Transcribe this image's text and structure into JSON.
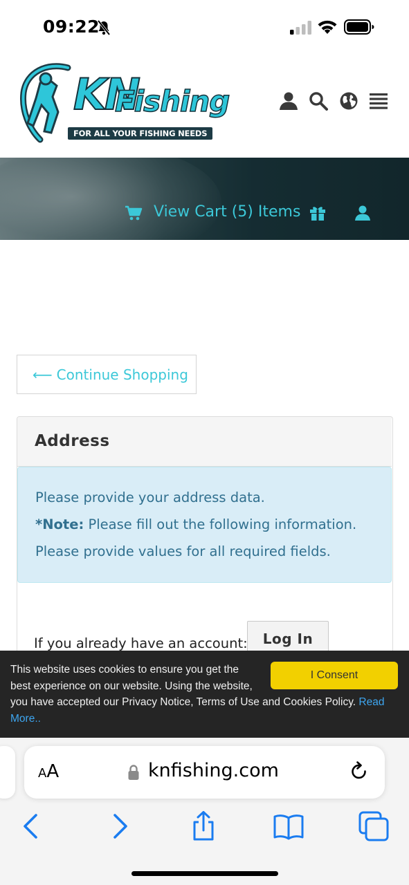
{
  "status_bar": {
    "time": "09:22"
  },
  "header": {
    "logo_kn": "KN",
    "logo_fishing": "Fishing",
    "logo_tagline": "FOR ALL YOUR FISHING NEEDS"
  },
  "banner": {
    "view_cart": "View Cart (5) Items"
  },
  "continue_shopping": {
    "arrow": "⟵",
    "label": "Continue Shopping"
  },
  "address": {
    "title": "Address",
    "info_line_1": "Please provide your address data.",
    "note_label": "*Note:",
    "note_text": " Please fill out the following information.",
    "info_line_3": "Please provide values for all required fields.",
    "account_prompt": "If you already have an account:",
    "login_label": "Log In"
  },
  "cookie_banner": {
    "text_line1": "This website uses cookies to ensure you get the best experience on our website. Using the website,",
    "text_line2": "you have accepted our Privacy Notice, Terms of Use and Cookies Policy. ",
    "read_more": "Read More..",
    "consent_label": "I Consent"
  },
  "browser": {
    "text_size_small": "A",
    "text_size_big": "A",
    "url": "knfishing.com"
  },
  "colors": {
    "accent": "#3cc8d8",
    "info_bg": "#d9edf7",
    "info_text": "#31708f",
    "consent": "#f2d000",
    "ios_blue": "#1a7cf0"
  }
}
